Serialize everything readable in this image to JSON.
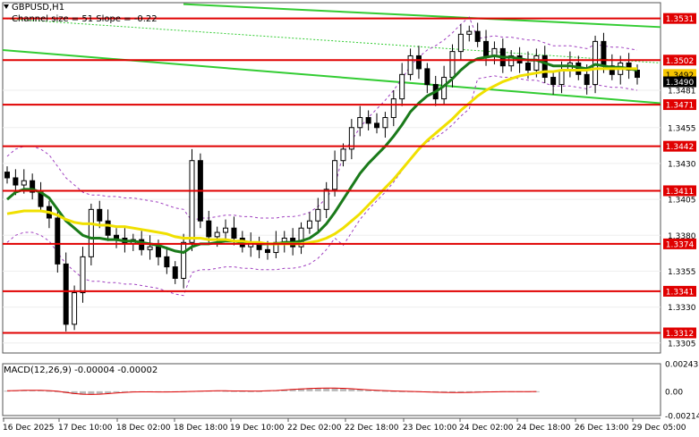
{
  "header": {
    "symbol": "GBPUSD,H1",
    "channel_info": "Channel size = 51 Slope = -0.22"
  },
  "macd": {
    "label": "MACD(12,26,9) -0.00004 -0.00002",
    "scale_labels": [
      "0.00243",
      "0.00",
      "-0.00214"
    ],
    "histogram": [
      5e-05,
      8e-05,
      0.0001,
      0.0001,
      8e-05,
      4e-05,
      -5e-05,
      -0.00015,
      -0.00025,
      -0.0003,
      -0.0003,
      -0.00025,
      -0.00018,
      -0.0001,
      -5e-05,
      -3e-05,
      -4e-05,
      -6e-05,
      -8e-05,
      -6e-05,
      -4e-05,
      -3e-05,
      2e-05,
      4e-05,
      5e-05,
      6e-05,
      4e-05,
      3e-05,
      2e-05,
      1e-05,
      2e-05,
      6e-05,
      0.0001,
      0.00015,
      0.0002,
      0.00025,
      0.00028,
      0.0003,
      0.0003,
      0.00028,
      0.00025,
      0.0002,
      0.00015,
      0.0001,
      6e-05,
      4e-05,
      2e-05,
      0.0,
      -2e-05,
      -5e-05,
      -8e-05,
      -0.0001,
      -0.00012,
      -0.00013,
      -0.00012,
      -0.0001,
      -6e-05,
      -4e-05,
      -3e-05,
      -4e-05,
      -4e-05,
      -3e-05,
      -3e-05,
      -4e-05
    ],
    "signal": [
      4e-05,
      6e-05,
      8e-05,
      9e-05,
      8e-05,
      6e-05,
      0.0,
      -0.0001,
      -0.0002,
      -0.00026,
      -0.00028,
      -0.00026,
      -0.00021,
      -0.00015,
      -0.0001,
      -6e-05,
      -5e-05,
      -5e-05,
      -6e-05,
      -6e-05,
      -5e-05,
      -4e-05,
      -1e-05,
      1e-05,
      3e-05,
      4e-05,
      4e-05,
      3e-05,
      3e-05,
      2e-05,
      2e-05,
      4e-05,
      7e-05,
      0.00011,
      0.00016,
      0.0002,
      0.00024,
      0.00027,
      0.00028,
      0.00028,
      0.00026,
      0.00022,
      0.00018,
      0.00013,
      9e-05,
      6e-05,
      3e-05,
      1e-05,
      -1e-05,
      -3e-05,
      -6e-05,
      -8e-05,
      -0.0001,
      -0.00011,
      -0.00011,
      -0.0001,
      -8e-05,
      -6e-05,
      -5e-05,
      -4e-05,
      -4e-05,
      -3e-05,
      -3e-05,
      -2e-05
    ]
  },
  "chart_data": {
    "type": "candlestick",
    "symbol": "GBPUSD",
    "timeframe": "H1",
    "ylim": [
      1.3298,
      1.3542
    ],
    "y_ticks": [
      1.3305,
      1.333,
      1.3355,
      1.338,
      1.3405,
      1.343,
      1.3455,
      1.3481
    ],
    "x_labels": [
      "16 Dec 2025",
      "17 Dec 10:00",
      "18 Dec 02:00",
      "18 Dec 18:00",
      "19 Dec 10:00",
      "22 Dec 02:00",
      "22 Dec 18:00",
      "23 Dec 10:00",
      "24 Dec 02:00",
      "24 Dec 18:00",
      "26 Dec 13:00",
      "29 Dec 05:00"
    ],
    "levels": [
      1.3531,
      1.3502,
      1.3471,
      1.3442,
      1.3411,
      1.3374,
      1.3341,
      1.3312
    ],
    "level_color": "#e00000",
    "current_price": "1.3490",
    "bid_price": "1.3492",
    "closes": [
      1.342,
      1.3415,
      1.3418,
      1.341,
      1.34,
      1.3392,
      1.336,
      1.3318,
      1.334,
      1.3365,
      1.3398,
      1.339,
      1.338,
      1.3378,
      1.3374,
      1.3377,
      1.337,
      1.3372,
      1.3365,
      1.3358,
      1.335,
      1.3375,
      1.3432,
      1.339,
      1.3379,
      1.3382,
      1.3385,
      1.3378,
      1.3372,
      1.3375,
      1.337,
      1.3368,
      1.3375,
      1.3378,
      1.3372,
      1.3385,
      1.339,
      1.3398,
      1.3412,
      1.3432,
      1.344,
      1.3455,
      1.3462,
      1.3458,
      1.3455,
      1.3462,
      1.3475,
      1.3492,
      1.3505,
      1.3496,
      1.3485,
      1.3475,
      1.349,
      1.3508,
      1.352,
      1.3522,
      1.3515,
      1.3505,
      1.351,
      1.3498,
      1.3505,
      1.35,
      1.3495,
      1.3505,
      1.349,
      1.3485,
      1.3495,
      1.35,
      1.3492,
      1.3485,
      1.3515,
      1.3498,
      1.3492,
      1.35,
      1.3495,
      1.349
    ],
    "series": [
      {
        "name": "MA fast",
        "color": "#1a7a1a",
        "values": [
          1.3405,
          1.341,
          1.3412,
          1.3412,
          1.341,
          1.3406,
          1.3398,
          1.339,
          1.3385,
          1.338,
          1.3378,
          1.3378,
          1.3377,
          1.3377,
          1.3376,
          1.3376,
          1.3375,
          1.3374,
          1.3373,
          1.3371,
          1.3369,
          1.3368,
          1.3372,
          1.3374,
          1.3374,
          1.3375,
          1.3376,
          1.3376,
          1.3375,
          1.3375,
          1.3374,
          1.3374,
          1.3374,
          1.3375,
          1.3375,
          1.3376,
          1.3378,
          1.3382,
          1.3388,
          1.3396,
          1.3405,
          1.3414,
          1.3423,
          1.343,
          1.3436,
          1.3442,
          1.3449,
          1.3457,
          1.3466,
          1.3472,
          1.3477,
          1.348,
          1.3484,
          1.3489,
          1.3495,
          1.35,
          1.3503,
          1.3504,
          1.3505,
          1.3504,
          1.3504,
          1.3503,
          1.3502,
          1.3502,
          1.35,
          1.3498,
          1.3498,
          1.3498,
          1.3497,
          1.3496,
          1.3499,
          1.3498,
          1.3497,
          1.3497,
          1.3496,
          1.3495
        ]
      },
      {
        "name": "MA slow",
        "color": "#f0e000",
        "values": [
          1.3395,
          1.3396,
          1.3397,
          1.3397,
          1.3397,
          1.3396,
          1.3394,
          1.3391,
          1.3389,
          1.3388,
          1.3388,
          1.3387,
          1.3387,
          1.3386,
          1.3386,
          1.3385,
          1.3384,
          1.3383,
          1.3382,
          1.3381,
          1.3379,
          1.3378,
          1.3378,
          1.3378,
          1.3377,
          1.3377,
          1.3377,
          1.3376,
          1.3376,
          1.3375,
          1.3375,
          1.3374,
          1.3374,
          1.3374,
          1.3374,
          1.3374,
          1.3375,
          1.3376,
          1.3378,
          1.3381,
          1.3385,
          1.339,
          1.3395,
          1.3401,
          1.3407,
          1.3413,
          1.3419,
          1.3426,
          1.3433,
          1.344,
          1.3446,
          1.3451,
          1.3456,
          1.3461,
          1.3467,
          1.3472,
          1.3477,
          1.3481,
          1.3484,
          1.3487,
          1.3489,
          1.3491,
          1.3492,
          1.3493,
          1.3494,
          1.3494,
          1.3495,
          1.3495,
          1.3495,
          1.3495,
          1.3496,
          1.3496,
          1.3496,
          1.3496,
          1.3496,
          1.3496
        ]
      }
    ]
  }
}
